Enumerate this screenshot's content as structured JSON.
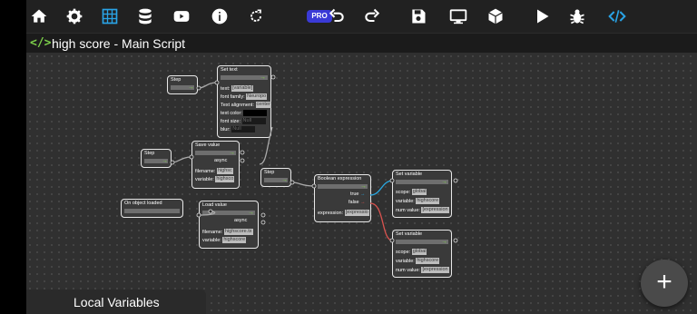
{
  "toolbar": {
    "items": [
      "home-icon",
      "gear-icon",
      "grid-icon",
      "database-icon",
      "youtube-icon",
      "info-icon",
      "refresh-icon",
      "undo-icon",
      "redo-icon",
      "save-icon",
      "monitor-icon",
      "cube-icon",
      "play-icon",
      "bug-icon",
      "code-icon"
    ],
    "pro_label": "PRO"
  },
  "title": {
    "icon": "</>",
    "text": "high score - Main Script"
  },
  "nodes": {
    "step1": {
      "title": "Step"
    },
    "set_text": {
      "title": "Set text",
      "rows": [
        {
          "label": "text:",
          "value": "[variable]"
        },
        {
          "label": "font family:",
          "value": "Neuropo"
        },
        {
          "label": "Text alignment:",
          "value": "center"
        },
        {
          "label": "text color:",
          "value": ""
        },
        {
          "label": "font size:",
          "value": "Null"
        },
        {
          "label": "blur:",
          "value": "Null"
        }
      ]
    },
    "step2": {
      "title": "Step"
    },
    "save_value": {
      "title": "Save value",
      "async": "async",
      "filename_label": "filename:",
      "filename": "highsc",
      "variable_label": "variable:",
      "variable": "highsco"
    },
    "step3": {
      "title": "Step"
    },
    "bool_expr": {
      "title": "Boolean expression",
      "true": "true",
      "false": "false",
      "expression_label": "expression:",
      "expression": "[expressio"
    },
    "set_var1": {
      "title": "Set variable",
      "scope_label": "scope:",
      "scope": "global",
      "variable_label": "variable:",
      "variable": "highscore",
      "num_label": "num value:",
      "num": "[expression"
    },
    "set_var2": {
      "title": "Set variable",
      "scope_label": "scope:",
      "scope": "global",
      "variable_label": "variable:",
      "variable": "highscore",
      "num_label": "num value:",
      "num": "[expression"
    },
    "on_loaded": {
      "title": "On object loaded"
    },
    "load_value": {
      "title": "Load value",
      "async": "async",
      "filename_label": "filename:",
      "filename": "highscore.tx",
      "variable_label": "variable:",
      "variable": "highscore"
    }
  },
  "local_variables": "Local Variables",
  "fab_label": "+",
  "colors": {
    "accent_green": "#7ccf4a",
    "pro_blue": "#3a3ad6",
    "wire_purple": "#b06cd8",
    "wire_red": "#d9534f",
    "wire_blue": "#2aa7e0"
  }
}
